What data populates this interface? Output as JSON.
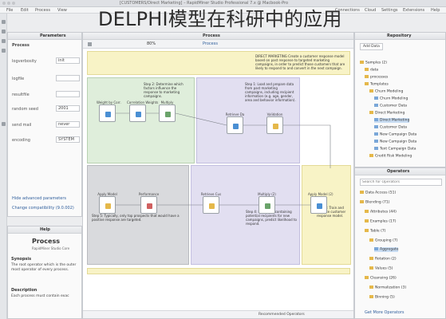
{
  "window": {
    "title": "[CUSTOMERS/Direct Marketing] – RapidMiner Studio Professional 7.x @ Macbook-Pro"
  },
  "heading": "DELPHI模型在科研中的应用",
  "menubar": {
    "items": [
      "File",
      "Edit",
      "Process",
      "View",
      "Connections",
      "Cloud",
      "Settings",
      "Extensions",
      "Help"
    ]
  },
  "parameters": {
    "title": "Parameters",
    "process_label": "Process",
    "rows": [
      {
        "label": "logverbosity",
        "value": "init"
      },
      {
        "label": "logfile",
        "value": ""
      },
      {
        "label": "resultfile",
        "value": ""
      },
      {
        "label": "random seed",
        "value": "2001"
      },
      {
        "label": "send mail",
        "value": "never"
      },
      {
        "label": "encoding",
        "value": "SYSTEM"
      }
    ],
    "hide_advanced": "Hide advanced parameters",
    "compat": "Change compatibility (9.0.002)"
  },
  "help": {
    "title": "Help",
    "op_name": "Process",
    "op_sub": "RapidMiner Studio Core",
    "synopsis_h": "Synopsis",
    "synopsis": "The root operator which is the outer most operator of every process.",
    "description_h": "Description",
    "description": "Each process must contain exac"
  },
  "process": {
    "title": "Process",
    "zoom": "80%",
    "breadcrumb": "Process",
    "notes": {
      "top": "DIRECT MARKETING Create a customer response model based on past response to targeted marketing campaigns, in order to predict those customers that are likely to respond to and convert in the next campaign.",
      "step1": "Step 1: Load and prepare data from past marketing campaigns, including recipient information (e.g. age, gender, area and behavior information).",
      "step2": "Step 2: Determine which factors influence the response to marketing campaigns.",
      "step3": "Step 3: Train and validate customer response model.",
      "step4": "Step 4: Load data containing potential recipients for new campaigns, predict likelihood to respond.",
      "step5": "Step 5: Typically, only top prospects that would have a positive response are targeted."
    },
    "operators": [
      {
        "name": "Retrieve Da"
      },
      {
        "name": "Multiply"
      },
      {
        "name": "Weight by Corr."
      },
      {
        "name": "Correlation Weights"
      },
      {
        "name": "Validation"
      },
      {
        "name": "Apply Model"
      },
      {
        "name": "Performance"
      },
      {
        "name": "Retrieve Cus"
      },
      {
        "name": "Multiply (2)"
      },
      {
        "name": "Apply Model (2)"
      }
    ]
  },
  "repository": {
    "title": "Repository",
    "add_data": "Add Data",
    "items": [
      "Samples (2)",
      "data",
      "processes",
      "Templates",
      "Churn Modeling",
      "Churn Modeling",
      "Customer Data",
      "Direct Marketing",
      "Direct Marketing",
      "Customer Data",
      "New Campaign Data",
      "New Campaign Data",
      "Text Campaign Data",
      "Credit Risk Modeling"
    ]
  },
  "operators": {
    "title": "Operators",
    "search_placeholder": "Search for Operators",
    "items": [
      "Data Access (51)",
      "Blending (71)",
      "Attributes (44)",
      "Examples (17)",
      "Table (7)",
      "Grouping (7)",
      "Aggregate",
      "Rotation (2)",
      "Values (5)",
      "Cleansing (26)",
      "Normalization (3)",
      "Binning (5)"
    ],
    "get_more": "Get More Operators"
  },
  "footer": {
    "recommended": "Recommended Operators"
  },
  "colors": {
    "zone_green": "#dfeedb",
    "zone_purple": "#e2dff1",
    "zone_yellow": "#f8f3c6",
    "zone_gray": "#d9dadd"
  }
}
